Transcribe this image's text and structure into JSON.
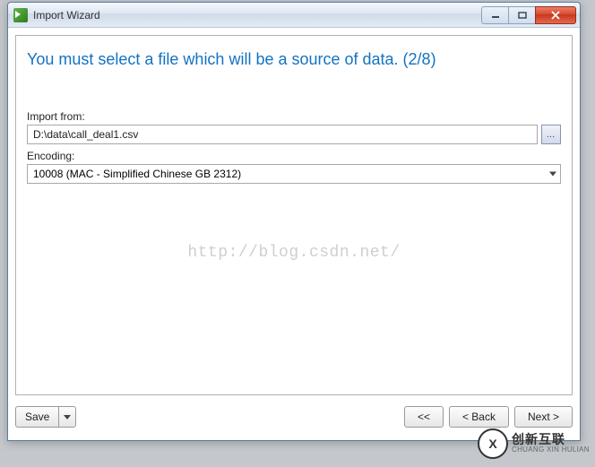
{
  "window": {
    "title": "Import Wizard"
  },
  "heading": "You must select a file which will be a source of data. (2/8)",
  "import_from": {
    "label": "Import from:",
    "value": "D:\\data\\call_deal1.csv"
  },
  "encoding": {
    "label": "Encoding:",
    "value": "10008 (MAC - Simplified Chinese GB 2312)"
  },
  "watermark": "http://blog.csdn.net/",
  "footer": {
    "save": "Save",
    "first": "<<",
    "back": "< Back",
    "next": "Next >"
  },
  "brand": {
    "logo": "X",
    "cn": "创新互联",
    "en": "CHUANG XIN HULIAN"
  }
}
